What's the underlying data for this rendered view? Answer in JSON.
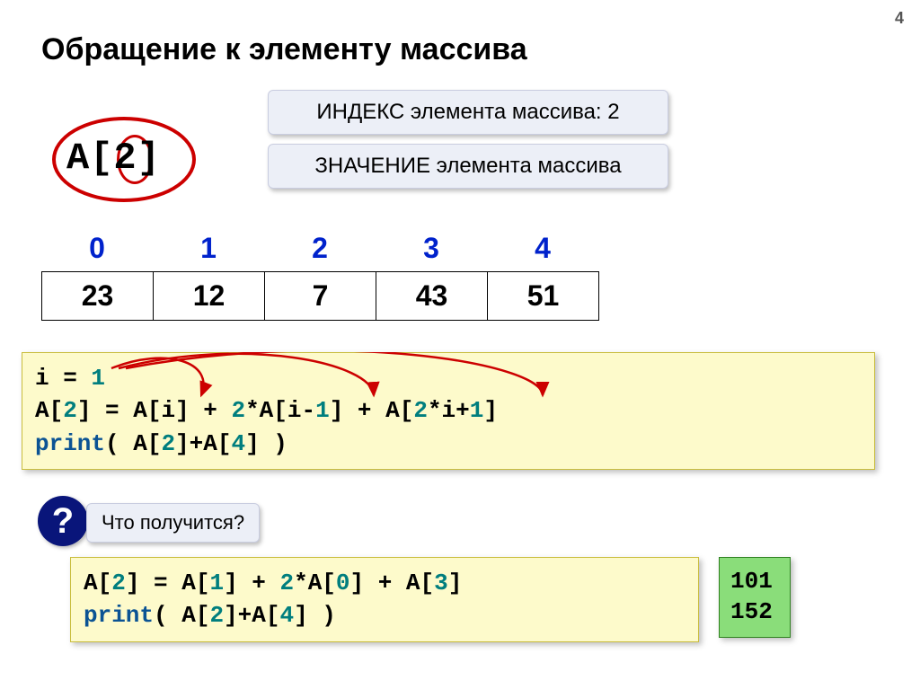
{
  "page_number": "4",
  "title": "Обращение к элементу массива",
  "callout_index": "ИНДЕКС элемента массива: 2",
  "callout_value": "ЗНАЧЕНИЕ элемента массива",
  "circled_expr_a": "A[",
  "circled_expr_n": "2",
  "circled_expr_b": "]",
  "indices": [
    "0",
    "1",
    "2",
    "3",
    "4"
  ],
  "values": [
    "23",
    "12",
    "7",
    "43",
    "51"
  ],
  "code1": {
    "l1a": "i = ",
    "l1n": "1",
    "l2a": "A[",
    "l2n1": "2",
    "l2b": "] = A[i] + ",
    "l2n2": "2",
    "l2c": "*A[i-",
    "l2n3": "1",
    "l2d": "] + A[",
    "l2n4": "2",
    "l2e": "*i+",
    "l2n5": "1",
    "l2f": "]",
    "l3kw": "print",
    "l3a": "( A[",
    "l3n1": "2",
    "l3b": "]+A[",
    "l3n2": "4",
    "l3c": "] )"
  },
  "question_mark": "?",
  "question_text": "Что получится?",
  "code2": {
    "l1a": "A[",
    "l1n1": "2",
    "l1b": "] = A[",
    "l1n2": "1",
    "l1c": "] + ",
    "l1n3": "2",
    "l1d": "*A[",
    "l1n4": "0",
    "l1e": "] + A[",
    "l1n5": "3",
    "l1f": "]",
    "l2kw": "print",
    "l2a": "( A[",
    "l2n1": "2",
    "l2b": "]+A[",
    "l2n2": "4",
    "l2c": "] )"
  },
  "results": [
    "101",
    "152"
  ]
}
